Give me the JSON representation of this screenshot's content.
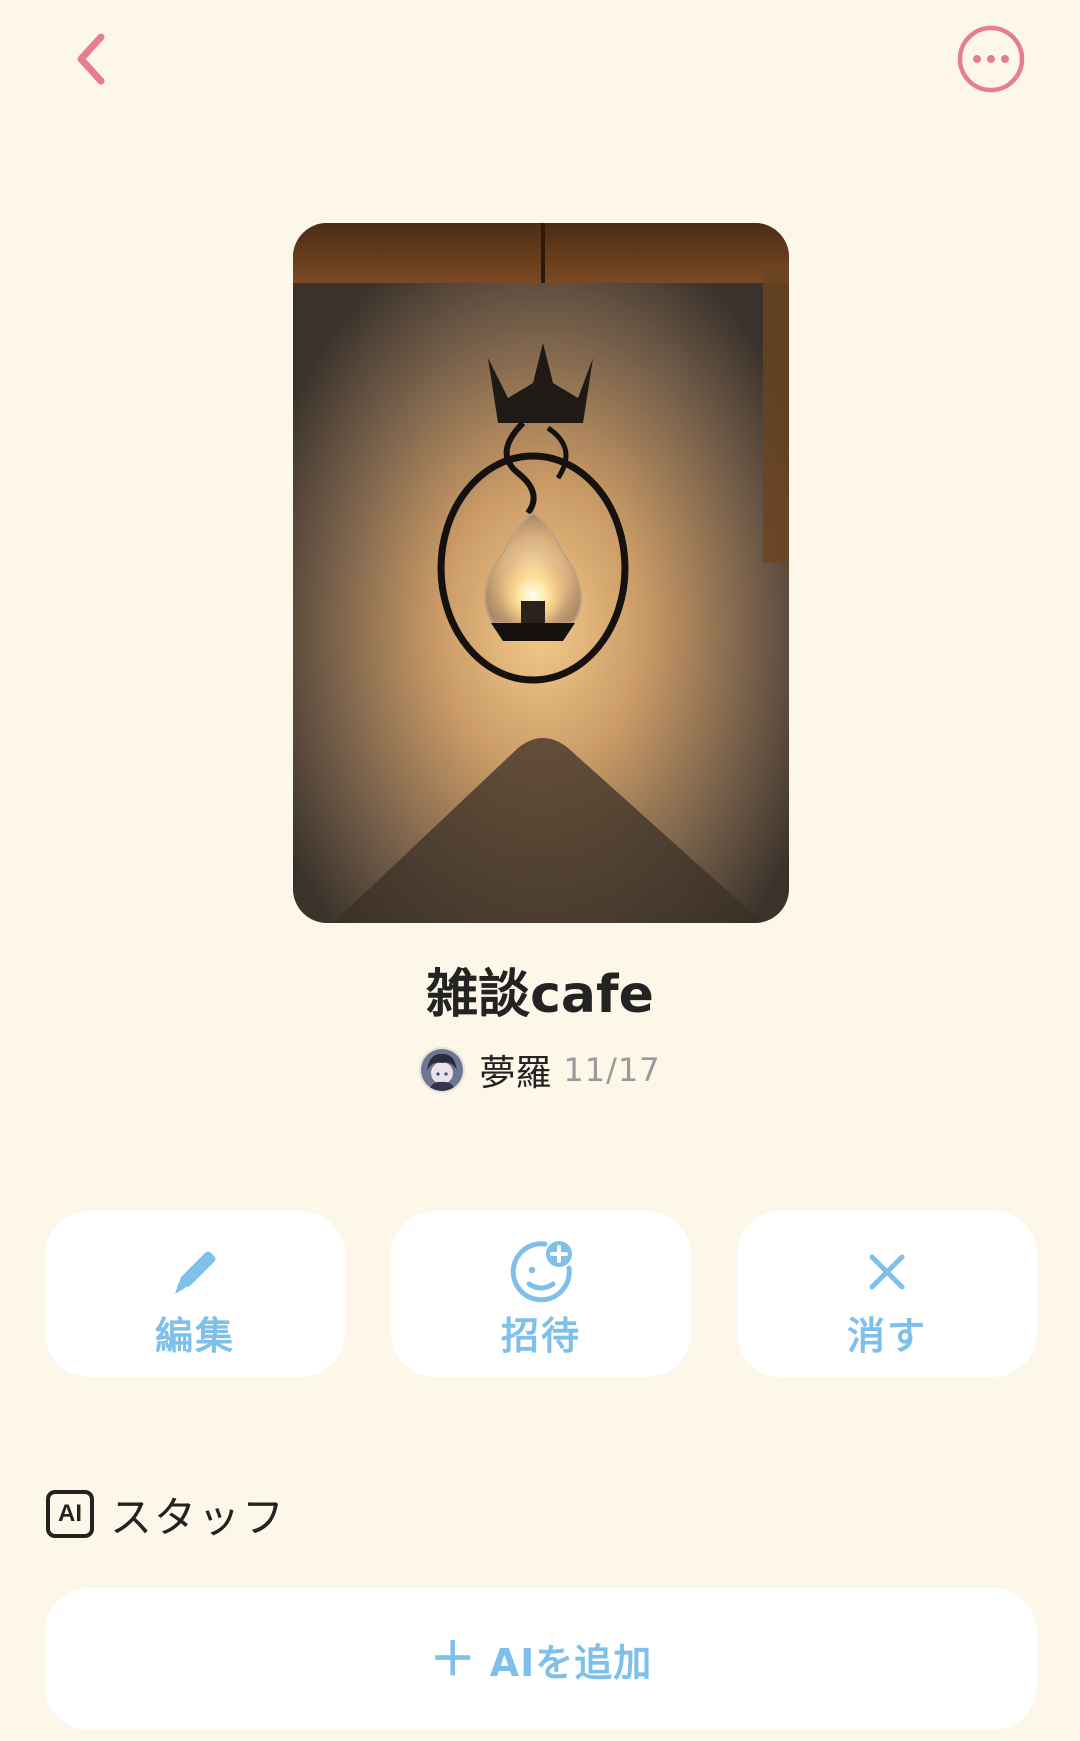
{
  "header": {
    "back_icon": "chevron-left-icon",
    "more_icon": "more-horizontal-icon",
    "accent_color": "#e57f8f"
  },
  "room": {
    "title": "雑談cafe",
    "author": "夢羅",
    "date": "11/17"
  },
  "actions": [
    {
      "label": "編集",
      "icon": "pencil-icon"
    },
    {
      "label": "招待",
      "icon": "add-friend-icon"
    },
    {
      "label": "消す",
      "icon": "close-icon"
    }
  ],
  "staff": {
    "badge": "AI",
    "title": "スタッフ",
    "add_plus": "＋",
    "add_label": "AIを追加"
  },
  "colors": {
    "background": "#fdf7e9",
    "action_blue": "#7fc0ea",
    "text": "#232323",
    "muted": "#9a9a9a"
  }
}
